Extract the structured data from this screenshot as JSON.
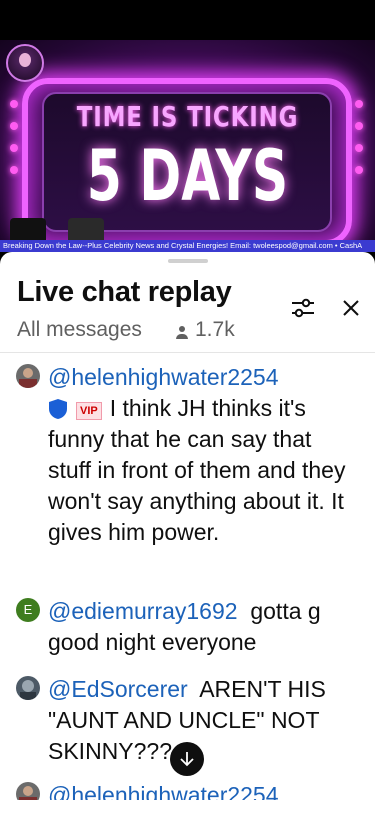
{
  "video": {
    "headline": "TIME IS TICKING",
    "countdown": "5 DAYS",
    "ticker": "Breaking Down the Law--Plus Celebrity News and Crystal Energies! Email: twoleespod@gmail.com • CashA"
  },
  "chat": {
    "title": "Live chat replay",
    "filter_label": "All messages",
    "viewer_count": "1.7k",
    "messages": [
      {
        "author": "@helenhighwater2254",
        "vip_label": "VIP",
        "text": "I think JH thinks it's funny that he can say that stuff in front of them and they won't say anything about it. It gives him power.",
        "avatar_color": "#5a5a5a"
      },
      {
        "author": "@ediemurray1692",
        "avatar_letter": "E",
        "text": "gotta g good night everyone",
        "avatar_color": "#3f7d1f"
      },
      {
        "author": "@EdSorcerer",
        "text": "AREN'T HIS \"AUNT AND UNCLE\" NOT SKINNY???",
        "avatar_color": "#4d5a66"
      },
      {
        "author": "@helenhighwater2254",
        "avatar_color": "#5a5a5a"
      }
    ]
  },
  "colors": {
    "author": "#1c62b9",
    "shield": "#1a5fd6"
  }
}
